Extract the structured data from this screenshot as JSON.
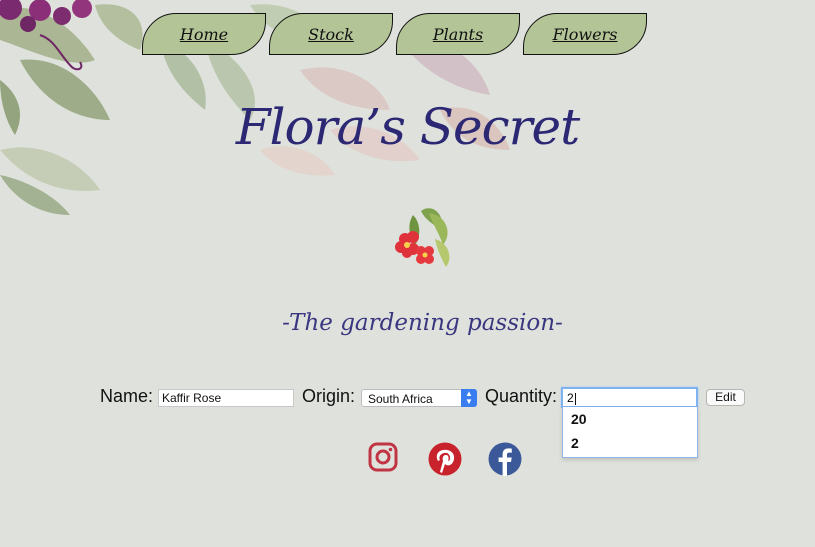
{
  "nav": {
    "items": [
      {
        "label": "Home"
      },
      {
        "label": "Stock"
      },
      {
        "label": "Plants"
      },
      {
        "label": "Flowers"
      }
    ]
  },
  "header": {
    "title": "Flora’s Secret"
  },
  "tagline": "-The gardening passion-",
  "form": {
    "name_label": "Name:",
    "name_value": "Kaffir Rose",
    "origin_label": "Origin:",
    "origin_value": "South Africa",
    "quantity_label": "Quantity:",
    "quantity_value": "2",
    "edit_label": "Edit"
  },
  "autocomplete": [
    "20",
    "2"
  ],
  "social": [
    {
      "icon": "instagram-icon",
      "color": "#c13444"
    },
    {
      "icon": "pinterest-icon",
      "color": "#c8232c"
    },
    {
      "icon": "facebook-icon",
      "color": "#3b5998"
    }
  ],
  "colors": {
    "background": "#dfe2dc",
    "nav_tab": "#b3c496",
    "title": "#2c2874"
  }
}
